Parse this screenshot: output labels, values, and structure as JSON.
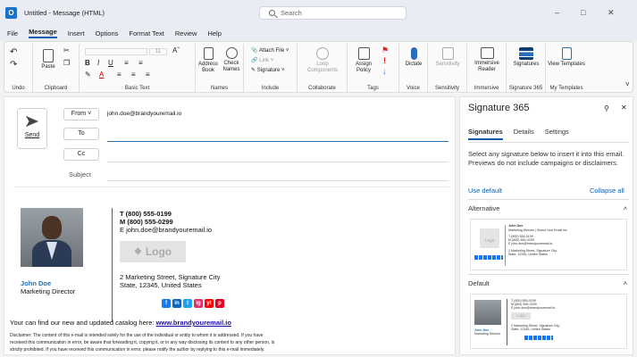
{
  "window": {
    "app_icon": "O",
    "title": "Untitled - Message (HTML)",
    "search_placeholder": "Search",
    "minimize": "–",
    "maximize": "□",
    "close": "✕"
  },
  "menu": {
    "items": [
      "File",
      "Message",
      "Insert",
      "Options",
      "Format Text",
      "Review",
      "Help"
    ],
    "active": "Message"
  },
  "ribbon": {
    "undo": {
      "label": "Undo"
    },
    "clipboard": {
      "paste": "Paste",
      "label": "Clipboard"
    },
    "basic_text": {
      "font_size": "11",
      "label": "Basic Text"
    },
    "names": {
      "address_book": "Address Book",
      "check_names": "Check Names",
      "label": "Names"
    },
    "include": {
      "attach_file": "Attach File",
      "link": "Link",
      "signature": "Signature",
      "label": "Include"
    },
    "collaborate": {
      "loop_components": "Loop Components",
      "label": "Collaborate"
    },
    "tags": {
      "assign_policy": "Assign Policy",
      "label": "Tags"
    },
    "voice": {
      "dictate": "Dictate",
      "label": "Voice"
    },
    "sensitivity": {
      "button": "Sensitivity",
      "label": "Sensitivity"
    },
    "immersive": {
      "reader": "Immersive Reader",
      "label": "Immersive"
    },
    "signature365": {
      "signatures": "Signatures",
      "label": "Signature 365"
    },
    "templates": {
      "view_templates": "View Templates",
      "label": "My Templates"
    }
  },
  "compose": {
    "send": "Send",
    "from_label": "From",
    "from_value": "john.doe@brandyouremail.io",
    "to_label": "To",
    "cc_label": "Cc",
    "subject_label": "Subject"
  },
  "signature": {
    "name": "John Doe",
    "title": "Marketing Director",
    "phone_t": "T (800) 555-0199",
    "phone_m": "M (800) 555-0299",
    "email": "E john.doe@brandyouremail.io",
    "logo_text": "Logo",
    "address_1": "2 Marketing Street, Signature City",
    "address_2": "State, 12345, United States",
    "social": [
      "f",
      "in",
      "t",
      "ig",
      "yt",
      "p"
    ],
    "catalog_prefix": "Your can find our new and updated catalog here: ",
    "catalog_link": "www.brandyouremail.io",
    "disclaimer_1": "Disclaimer: The content of this e-mail is intended solely for the use of the individual or entity to whom it is addressed. If you have",
    "disclaimer_2": "received this communication in error, be aware that forwarding it, copying it, or in any way disclosing its content to any other person, is",
    "disclaimer_3": "strictly prohibited. If you have received this communication in error, please notify the author by replying to this e-mail immediately."
  },
  "panel": {
    "title": "Signature 365",
    "tabs": [
      "Signatures",
      "Details",
      "Settings"
    ],
    "active_tab": "Signatures",
    "description": "Select any signature below to insert it into this email. Previews do not include campaigns or disclaimers.",
    "use_default": "Use default",
    "collapse_all": "Collapse all",
    "sections": [
      "Alternative",
      "Default"
    ],
    "alt_preview": {
      "name": "John Doe",
      "title": "Marketing Director | Brand Your Email Inc",
      "l1": "T (800) 555-0199",
      "l2": "M (800) 555-0299",
      "l3": "E john.doe@brandyouremail.io",
      "logo": "Logo",
      "addr1": "2 Marketing Street, Signature City,",
      "addr2": "State, 12345, United States"
    },
    "def_preview": {
      "l1": "T (800) 555-0199",
      "l2": "M (800) 555-0299",
      "l3": "E john.doe@brandyouremail.io",
      "logo": "Logo",
      "name": "John Doe",
      "title": "Marketing Director",
      "addr1": "2 Marketing Street, Signature City,",
      "addr2": "State, 12345, United States"
    }
  },
  "colors": {
    "accent": "#0f5fa8",
    "facebook": "#1877f2",
    "linkedin": "#0a66c2",
    "twitter": "#1da1f2",
    "instagram": "#e1306c",
    "youtube": "#ff0000",
    "pinterest": "#e60023"
  }
}
